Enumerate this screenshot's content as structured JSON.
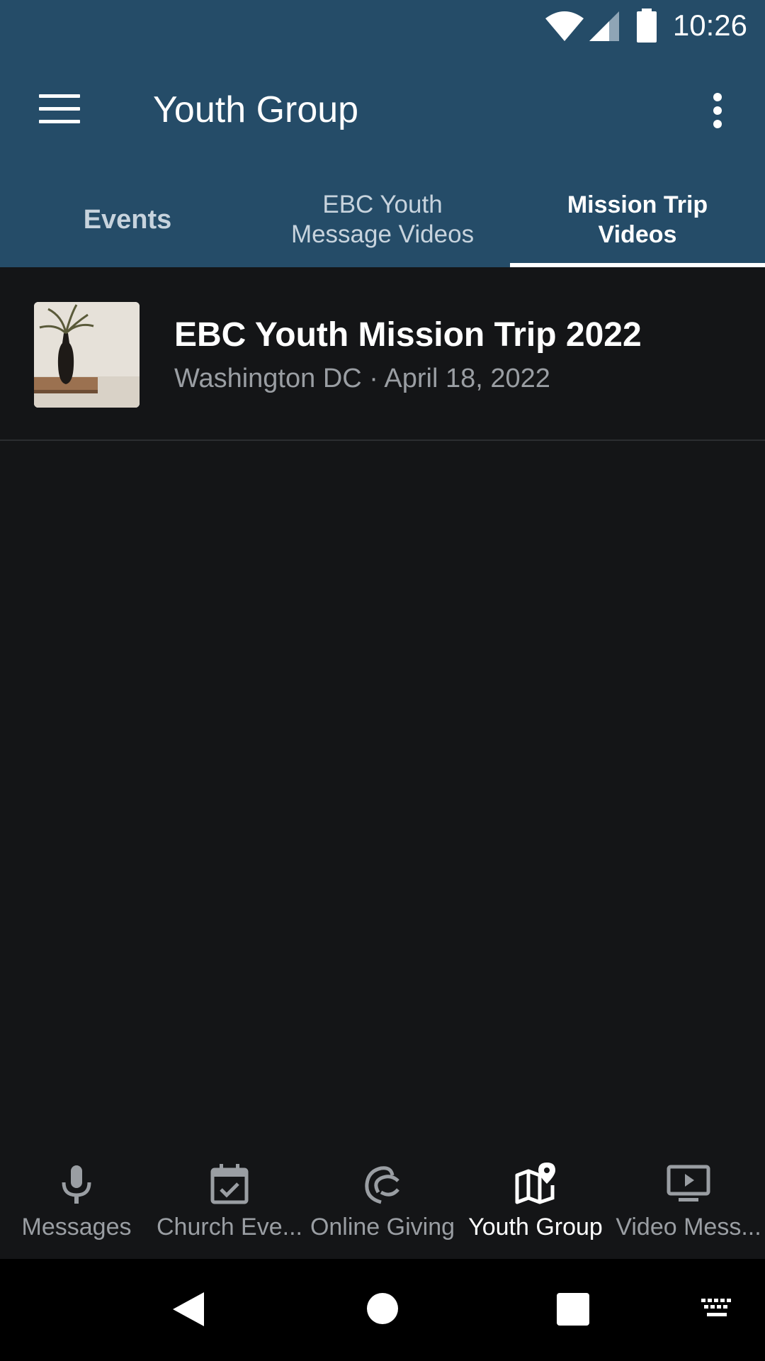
{
  "status_bar": {
    "time": "10:26"
  },
  "app_bar": {
    "title": "Youth Group"
  },
  "tabs": [
    {
      "label": "Events",
      "active": false
    },
    {
      "label": "EBC Youth Message Videos",
      "line1": "EBC Youth",
      "line2": "Message Videos",
      "active": false
    },
    {
      "label": "Mission Trip Videos",
      "line1": "Mission Trip",
      "line2": "Videos",
      "active": true
    }
  ],
  "list": [
    {
      "title": "EBC Youth Mission Trip 2022",
      "subtitle": "Washington DC · April 18, 2022",
      "thumbnail_icon": "vase-photo"
    }
  ],
  "bottom_nav": [
    {
      "label": "Messages",
      "icon": "microphone-icon",
      "active": false
    },
    {
      "label": "Church Eve...",
      "icon": "calendar-check-icon",
      "active": false
    },
    {
      "label": "Online Giving",
      "icon": "giving-icon",
      "active": false
    },
    {
      "label": "Youth Group",
      "icon": "map-pin-icon",
      "active": true
    },
    {
      "label": "Video Mess...",
      "icon": "tv-play-icon",
      "active": false
    }
  ],
  "colors": {
    "header": "#254C68",
    "background": "#141517",
    "inactive_text": "#9A9EA3"
  }
}
